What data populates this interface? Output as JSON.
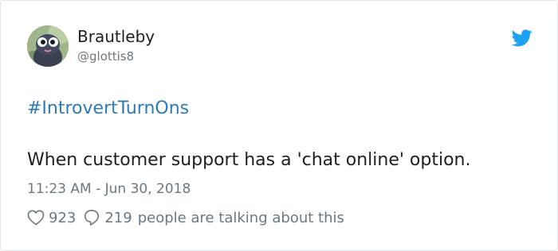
{
  "user": {
    "display_name": "Brautleby",
    "handle": "@glottis8",
    "avatar_icon": "avatar-owl"
  },
  "tweet": {
    "hashtag": "#IntrovertTurnOns",
    "text": "When customer support has a 'chat online' option.",
    "timestamp": "11:23 AM - Jun 30, 2018"
  },
  "stats": {
    "likes": "923",
    "replies": "219",
    "talking_text": "people are talking about this"
  },
  "icons": {
    "brand": "twitter-bird-icon",
    "like": "heart-icon",
    "reply": "speech-bubble-icon"
  },
  "colors": {
    "link": "#2b7bb9",
    "muted": "#697882",
    "text": "#1c2022",
    "brand": "#1da1f2",
    "border": "#e1e8ed"
  }
}
